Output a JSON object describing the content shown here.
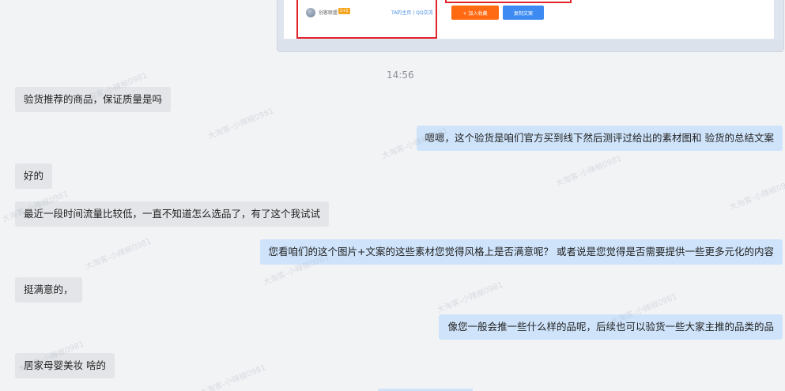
{
  "shared_card": {
    "shop_name": "创客联盟",
    "shop_tag": "1+1",
    "shop_links": "TA的主页 | QQ交流",
    "add_fav_label": "+ 加入收藏",
    "copy_label": "复制文案"
  },
  "timestamp": "14:56",
  "messages": [
    {
      "side": "left",
      "text": "验货推荐的商品，保证质量是吗"
    },
    {
      "side": "right",
      "text": "嗯嗯，这个验货是咱们官方买到线下然后测评过给出的素材图和 验货的总结文案"
    },
    {
      "side": "left",
      "text": "好的"
    },
    {
      "side": "left",
      "text": "最近一段时间流量比较低，一直不知道怎么选品了，有了这个我试试"
    },
    {
      "side": "right",
      "text": "您看咱们的这个图片+文案的这些素材您觉得风格上是否满意呢？  或者说是您觉得是否需要提供一些更多元化的内容"
    },
    {
      "side": "left",
      "text": "挺满意的，"
    },
    {
      "side": "right",
      "text": "像您一般会推一些什么样的品呢，后续也可以验货一些大家主推的品类的品"
    },
    {
      "side": "left",
      "text": "居家母婴美妆 啥的"
    }
  ],
  "watermark": "大淘客-小辣椒0981"
}
